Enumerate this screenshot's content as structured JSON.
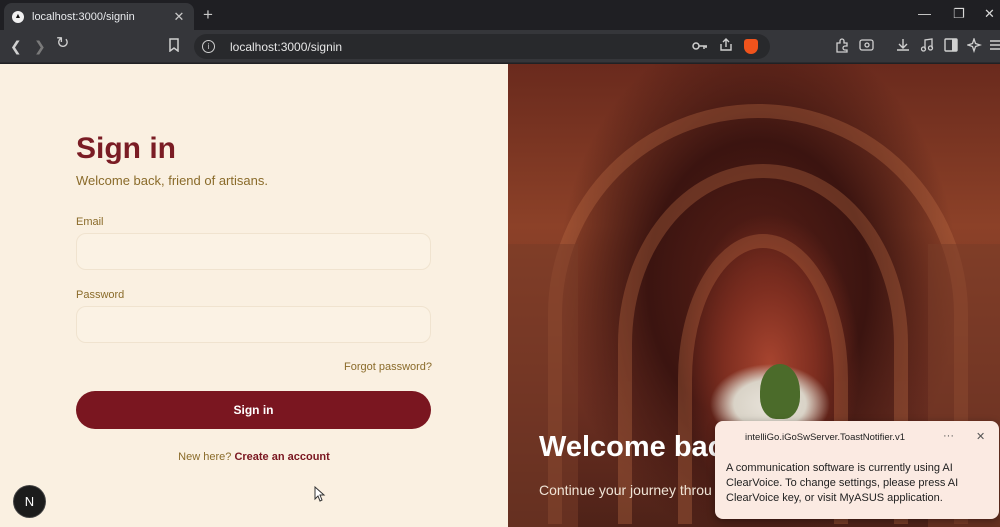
{
  "browser": {
    "tab": {
      "title": "localhost:3000/signin",
      "favicon": "▲",
      "close": "✕"
    },
    "new_tab": "+",
    "window_controls": {
      "minimize": "—",
      "restore": "❐",
      "close": "✕"
    },
    "nav": {
      "back": "❮",
      "forward": "❯",
      "reload": "↻",
      "bookmark": "🔖"
    },
    "url": "localhost:3000/signin",
    "info_icon": "i"
  },
  "signin": {
    "title": "Sign in",
    "subtitle": "Welcome back, friend of artisans.",
    "email_label": "Email",
    "password_label": "Password",
    "forgot": "Forgot password?",
    "submit": "Sign in",
    "new_here": "New here?",
    "create_account": "Create an account"
  },
  "hero": {
    "heading": "Welcome bac",
    "subtext": "Continue your journey throu"
  },
  "devtools_badge": "N",
  "toast": {
    "app": "intelliGo.iGoSwServer.ToastNotifier.v1",
    "more": "···",
    "close": "✕",
    "message": "A communication software is currently using AI ClearVoice. To change settings, please press AI ClearVoice key, or visit MyASUS application."
  }
}
